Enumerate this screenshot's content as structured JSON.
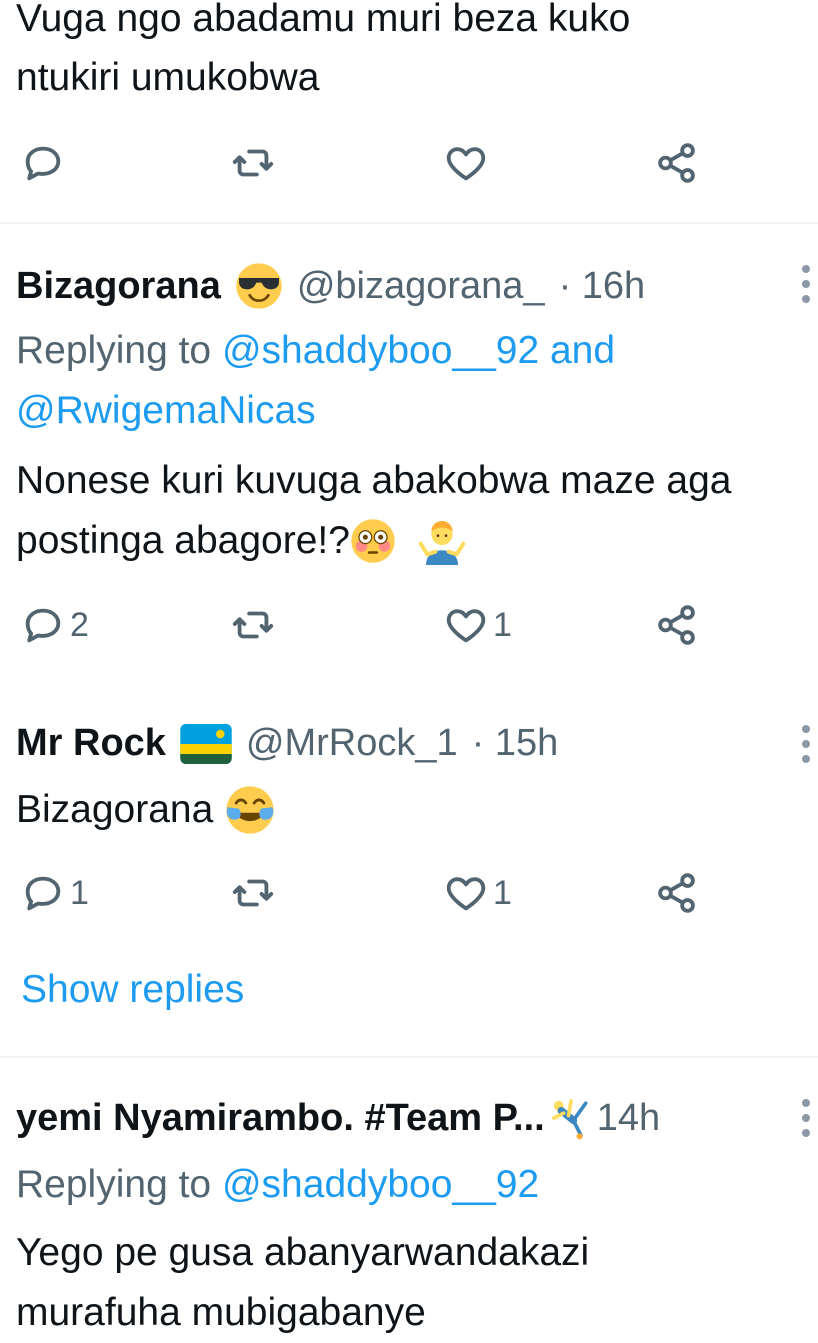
{
  "tweet1": {
    "text_line1": "Vuga ngo abadamu muri beza kuko",
    "text_line2": "ntukiri umukobwa",
    "actions": {
      "reply_count": "",
      "retweet_count": "",
      "like_count": ""
    }
  },
  "tweet2": {
    "name": "Bizagorana",
    "name_emoji": "smiling-face-with-sunglasses",
    "handle": "@bizagorana_",
    "time": "· 16h",
    "replying_prefix": "Replying to",
    "replying_users_line1": "@shaddyboo__92 and",
    "replying_users_line2": "@RwigemaNicas",
    "text_line1": "Nonese kuri kuvuga abakobwa maze aga",
    "text_line2": "postinga abagore!?",
    "text_emojis": [
      "flushed-face",
      "man-shrugging"
    ],
    "reply_count": "2",
    "like_count": "1"
  },
  "tweet3": {
    "name": "Mr Rock",
    "name_emoji": "rwanda-flag",
    "handle": "@MrRock_1",
    "time": "· 15h",
    "text": "Bizagorana",
    "text_emoji": "face-with-tears-of-joy",
    "reply_count": "1",
    "like_count": "1",
    "show_replies": "Show replies"
  },
  "tweet4": {
    "name": "yemi Nyamirambo. #Team P...",
    "name_emoji": "person-cartwheeling",
    "time": "14h",
    "replying_prefix": "Replying to",
    "replying_users": "@shaddyboo__92",
    "text_line1": "Yego pe gusa abanyarwandakazi",
    "text_line2": "murafuha mubigabanye"
  },
  "colors": {
    "accent": "#1d9bf0",
    "secondary_text": "#536471",
    "primary_text": "#0f1419",
    "divider": "#eff3f4"
  }
}
